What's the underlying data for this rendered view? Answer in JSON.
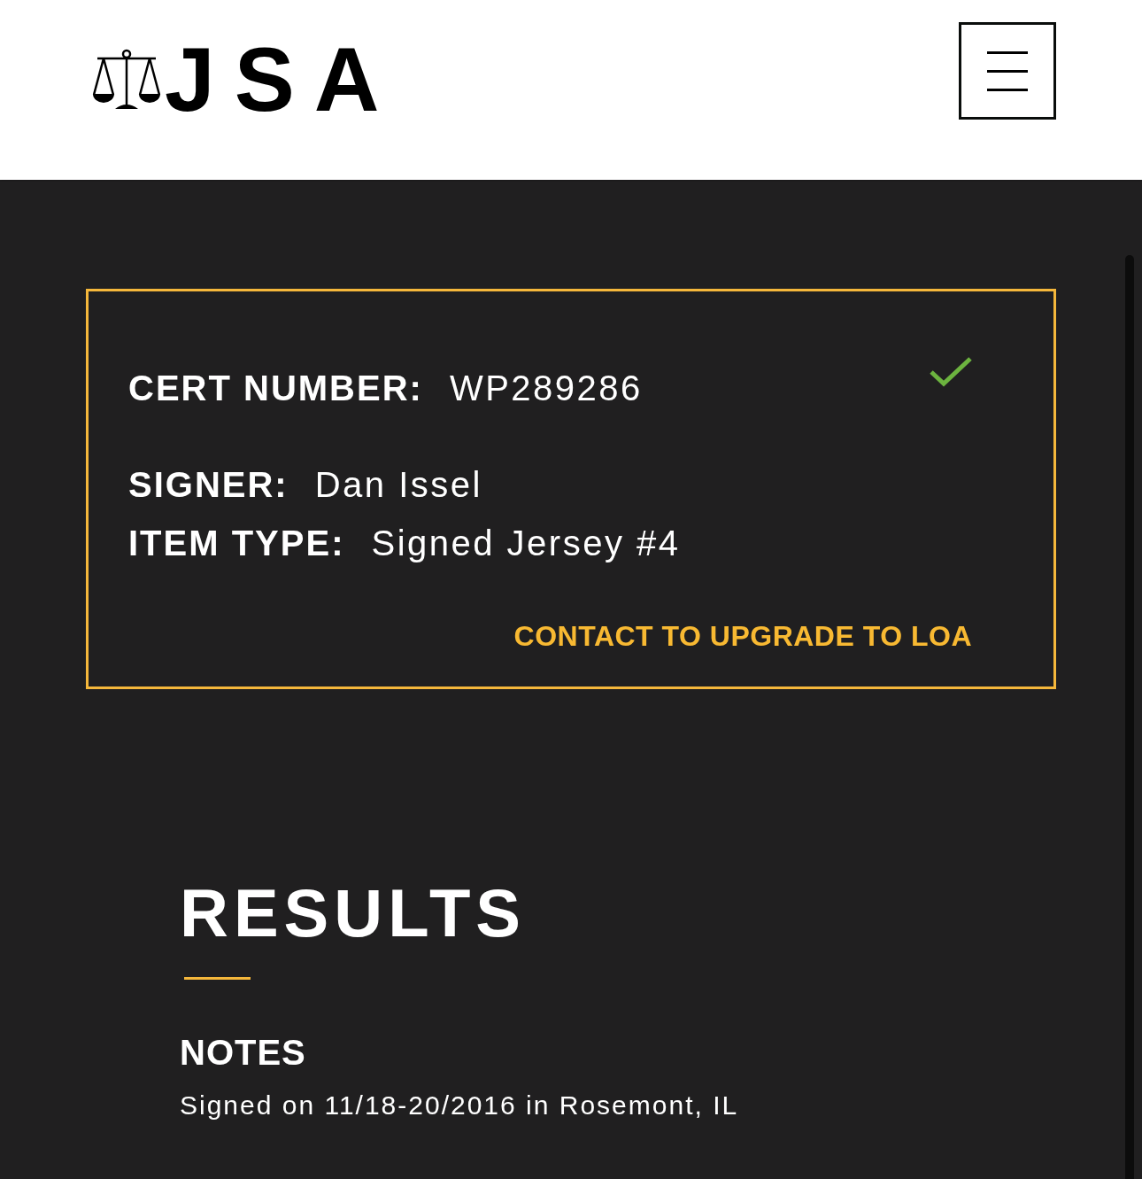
{
  "header": {
    "logo_text": "JSA"
  },
  "certificate": {
    "verified": true,
    "cert_number": {
      "label": "CERT NUMBER:",
      "value": "WP289286"
    },
    "fields": [
      {
        "label": "SIGNER:",
        "value": "Dan Issel"
      },
      {
        "label": "ITEM TYPE:",
        "value": "Signed Jersey #4"
      }
    ],
    "upgrade_link": "CONTACT TO UPGRADE TO LOA"
  },
  "results": {
    "title": "RESULTS",
    "notes_heading": "NOTES",
    "notes": "Signed on 11/18-20/2016 in Rosemont, IL"
  }
}
